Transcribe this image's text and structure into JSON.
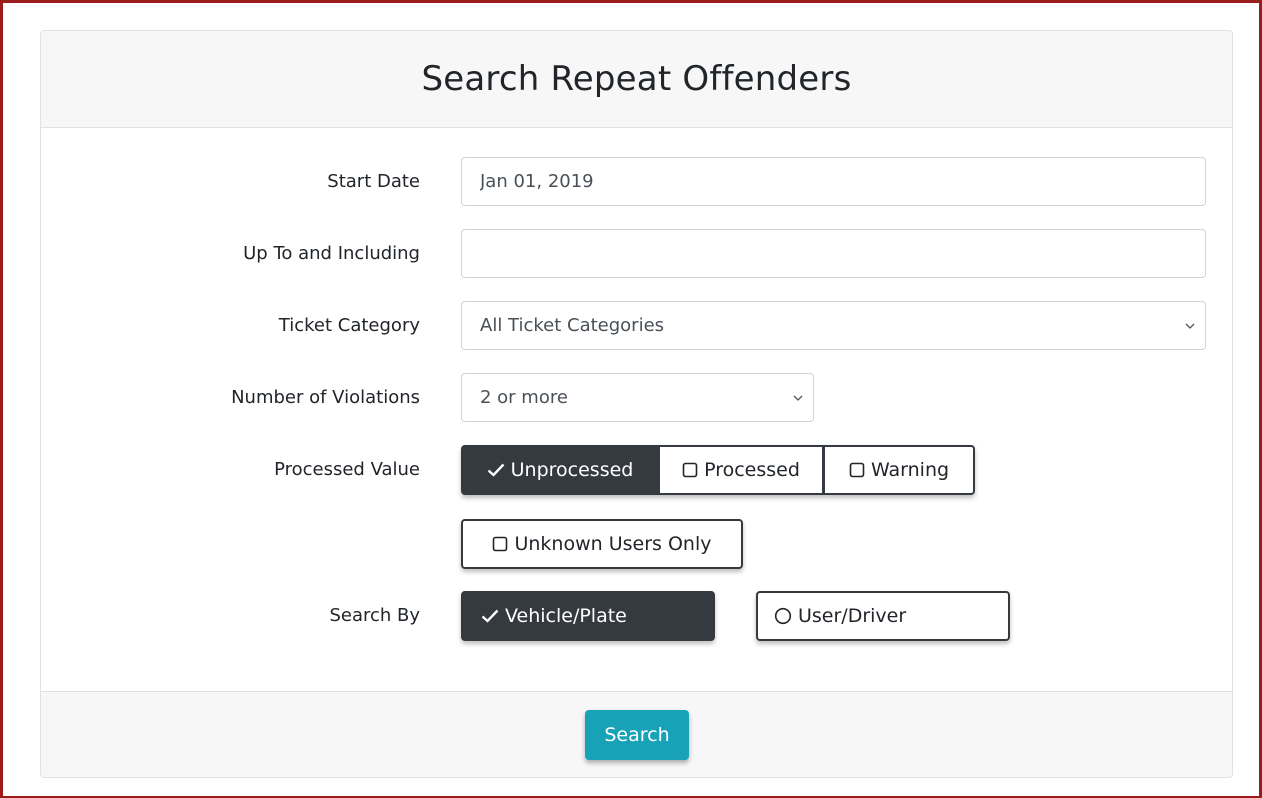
{
  "header": {
    "title": "Search Repeat Offenders"
  },
  "form": {
    "start_date": {
      "label": "Start Date",
      "value": "Jan 01, 2019"
    },
    "end_date": {
      "label": "Up To and Including",
      "value": ""
    },
    "ticket_category": {
      "label": "Ticket Category",
      "selected": "All Ticket Categories"
    },
    "violations": {
      "label": "Number of Violations",
      "selected": "2 or more"
    },
    "processed": {
      "label": "Processed Value",
      "options": [
        {
          "label": "Unprocessed",
          "checked": true
        },
        {
          "label": "Processed",
          "checked": false
        },
        {
          "label": "Warning",
          "checked": false
        }
      ]
    },
    "unknown_users": {
      "label": "Unknown Users Only",
      "checked": false
    },
    "search_by": {
      "label": "Search By",
      "options": [
        {
          "label": "Vehicle/Plate",
          "selected": true
        },
        {
          "label": "User/Driver",
          "selected": false
        }
      ]
    }
  },
  "footer": {
    "search_label": "Search"
  },
  "colors": {
    "dark": "#343a40",
    "info": "#17a2b8",
    "frame": "#9c1c1c"
  },
  "icons": {
    "check": "check-icon",
    "checkbox": "checkbox-empty-icon",
    "radio": "radio-empty-icon",
    "chevron": "chevron-down-icon"
  }
}
